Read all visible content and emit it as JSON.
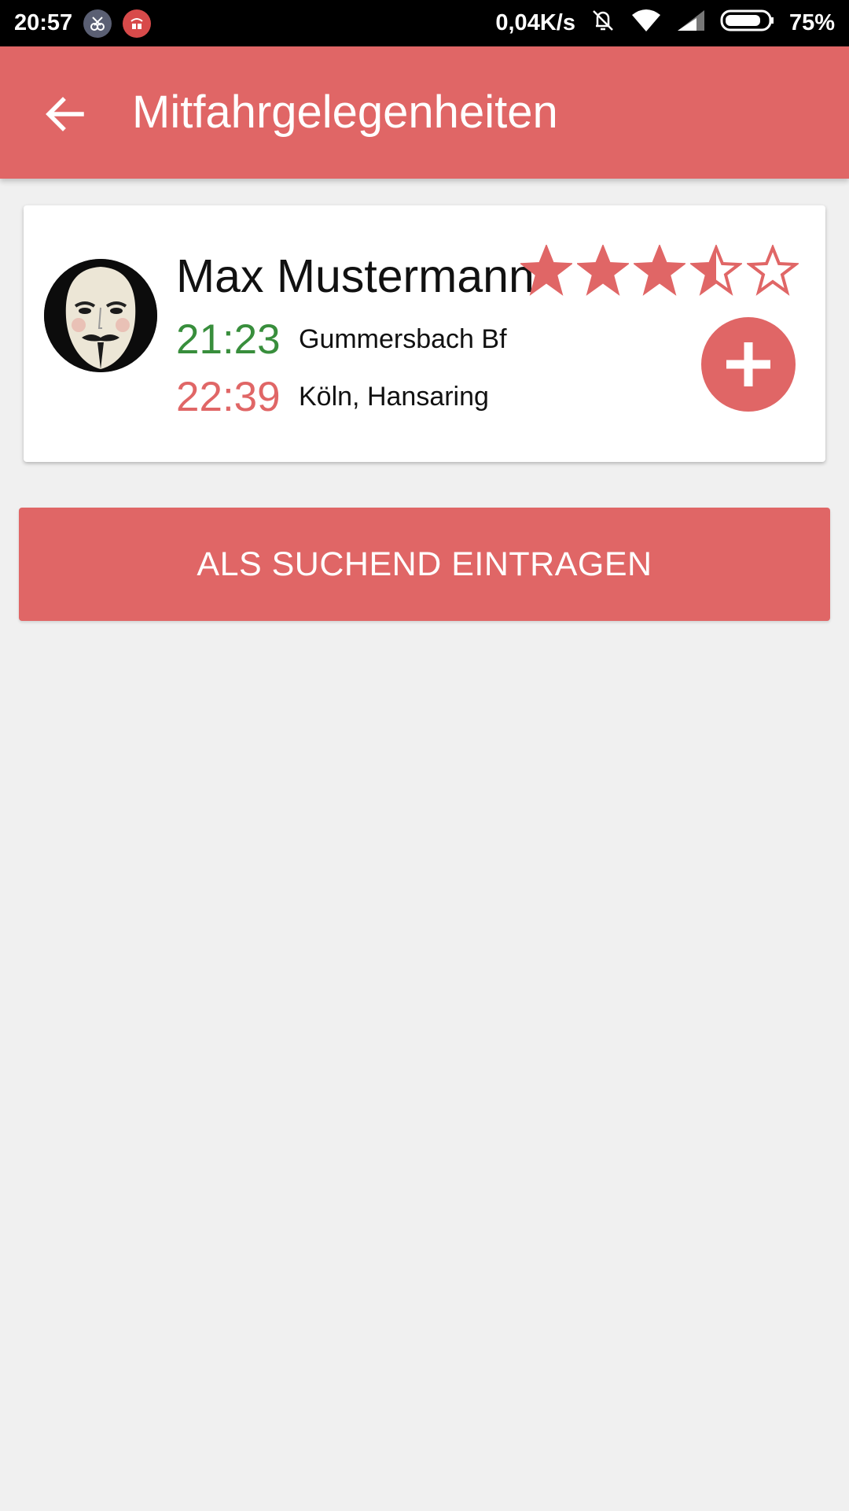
{
  "status_bar": {
    "time": "20:57",
    "net_speed": "0,04K/s",
    "battery_percent": "75%",
    "icons": [
      "app-notification-icon",
      "app-notification-icon",
      "vibrate-off-icon",
      "wifi-icon",
      "signal-icon",
      "battery-icon"
    ]
  },
  "app_bar": {
    "title": "Mitfahrgelegenheiten",
    "back_icon": "arrow-back-icon"
  },
  "ride": {
    "driver_name": "Max Mustermann",
    "rating": 3.5,
    "rating_max": 5,
    "departure_time": "21:23",
    "departure_place": "Gummersbach Bf",
    "arrival_time": "22:39",
    "arrival_place": "Köln, Hansaring",
    "add_icon": "plus-icon"
  },
  "actions": {
    "register_label": "ALS SUCHEND EINTRAGEN"
  },
  "colors": {
    "primary": "#e06666",
    "departure": "#388e3c",
    "arrival": "#e06666",
    "background": "#f0f0f0"
  }
}
